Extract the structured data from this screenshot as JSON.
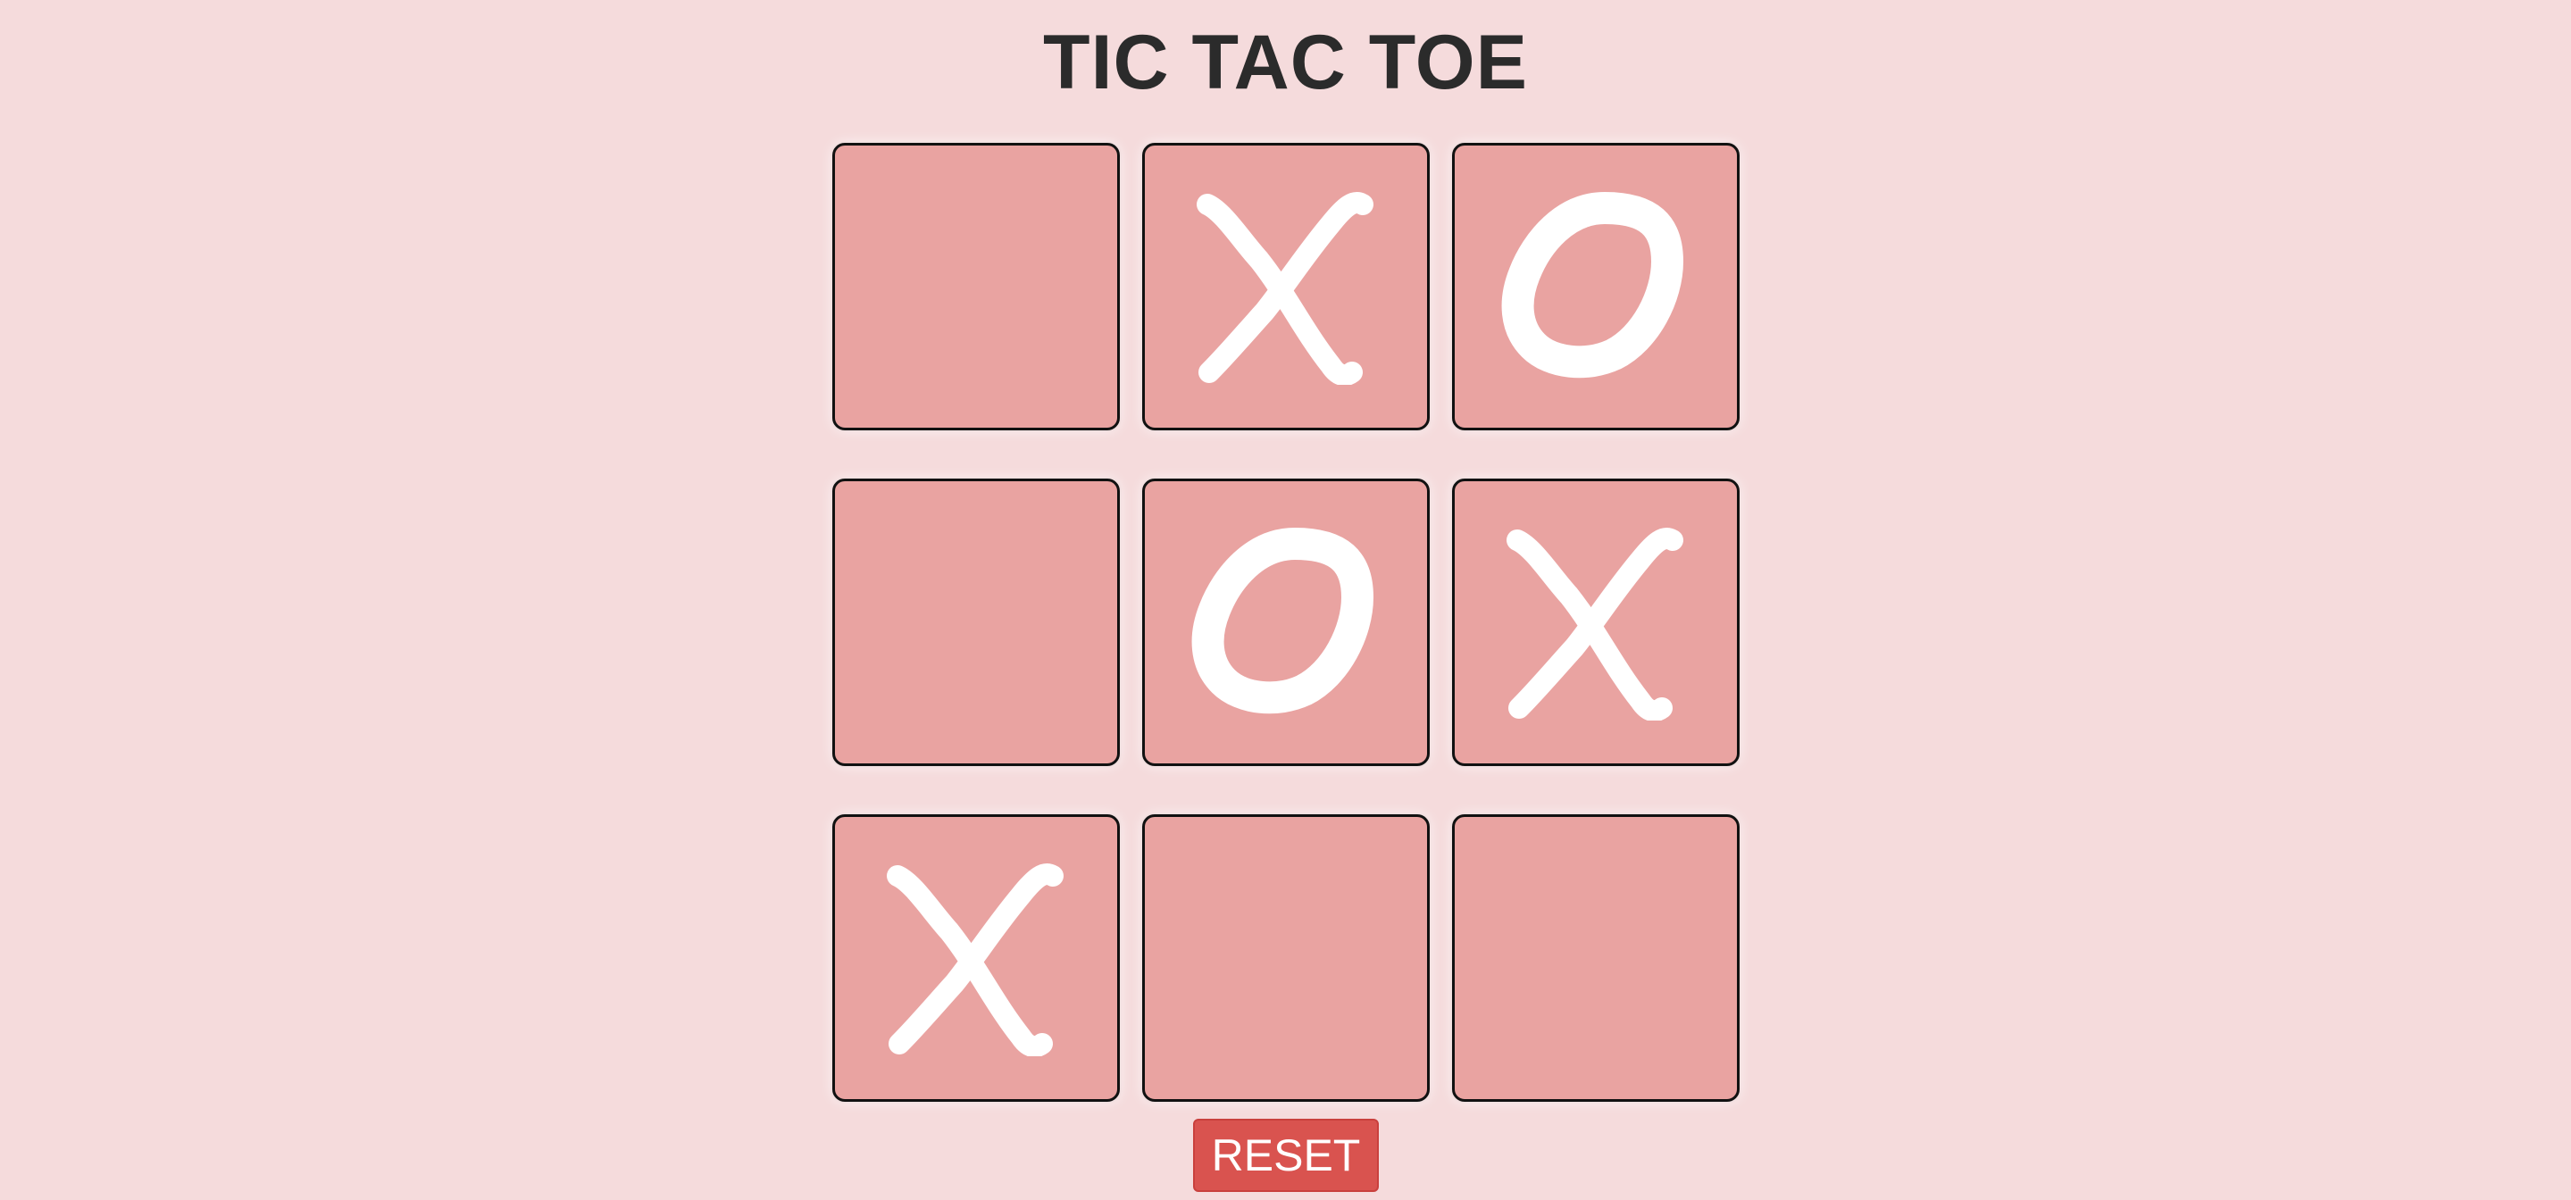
{
  "title": "TIC TAC TOE",
  "board": [
    "",
    "X",
    "O",
    "",
    "O",
    "X",
    "X",
    "",
    ""
  ],
  "reset_label": "RESET",
  "colors": {
    "background": "#f5dbdc",
    "cell": "#e9a3a1",
    "cell_border": "#111111",
    "mark": "#ffffff",
    "reset_button": "#d9534f",
    "title": "#2b2b2b"
  }
}
